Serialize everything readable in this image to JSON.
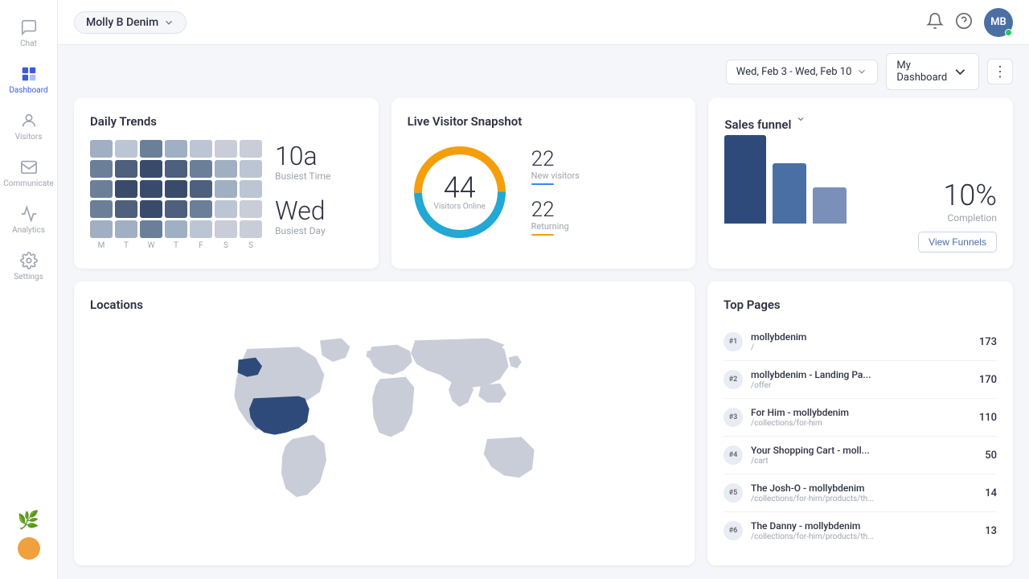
{
  "sidebar": {
    "items": [
      {
        "label": "Chat",
        "icon": "chat-icon",
        "active": false
      },
      {
        "label": "Dashboard",
        "icon": "dashboard-icon",
        "active": true
      },
      {
        "label": "Visitors",
        "icon": "visitors-icon",
        "active": false
      },
      {
        "label": "Communicate",
        "icon": "communicate-icon",
        "active": false
      },
      {
        "label": "Analytics",
        "icon": "analytics-icon",
        "active": false
      },
      {
        "label": "Settings",
        "icon": "settings-icon",
        "active": false
      }
    ]
  },
  "topbar": {
    "store_name": "Molly B Denim",
    "user_initials": "MB"
  },
  "controls": {
    "date_range": "Wed, Feb 3 - Wed, Feb 10",
    "dashboard_label": "My Dashboard"
  },
  "daily_trends": {
    "title": "Daily Trends",
    "busiest_time": "10a",
    "busiest_time_label": "Busiest Time",
    "busiest_day": "Wed",
    "busiest_day_label": "Busiest Day",
    "days": [
      "M",
      "T",
      "W",
      "T",
      "F",
      "S",
      "S"
    ]
  },
  "live_snapshot": {
    "title": "Live Visitor Snapshot",
    "visitors_online": "44",
    "visitors_online_label": "Visitors Online",
    "new_visitors": "22",
    "new_visitors_label": "New visitors",
    "returning": "22",
    "returning_label": "Returning"
  },
  "sales_funnel": {
    "title": "Sales funnel",
    "completion_pct": "10%",
    "completion_label": "Completion",
    "view_funnels_btn": "View Funnels"
  },
  "locations": {
    "title": "Locations"
  },
  "top_pages": {
    "title": "Top Pages",
    "pages": [
      {
        "rank": "#1",
        "name": "mollybdenim",
        "url": "/",
        "count": "173"
      },
      {
        "rank": "#2",
        "name": "mollybdenim - Landing Pa...",
        "url": "/offer",
        "count": "170"
      },
      {
        "rank": "#3",
        "name": "For Him - mollybdenim",
        "url": "/collections/for-him",
        "count": "110"
      },
      {
        "rank": "#4",
        "name": "Your Shopping Cart - moll...",
        "url": "/cart",
        "count": "50"
      },
      {
        "rank": "#5",
        "name": "The Josh-O - mollybdenim",
        "url": "/collections/for-him/products/th...",
        "count": "14"
      },
      {
        "rank": "#6",
        "name": "The Danny - mollybdenim",
        "url": "/collections/for-him/products/th...",
        "count": "13"
      }
    ]
  }
}
